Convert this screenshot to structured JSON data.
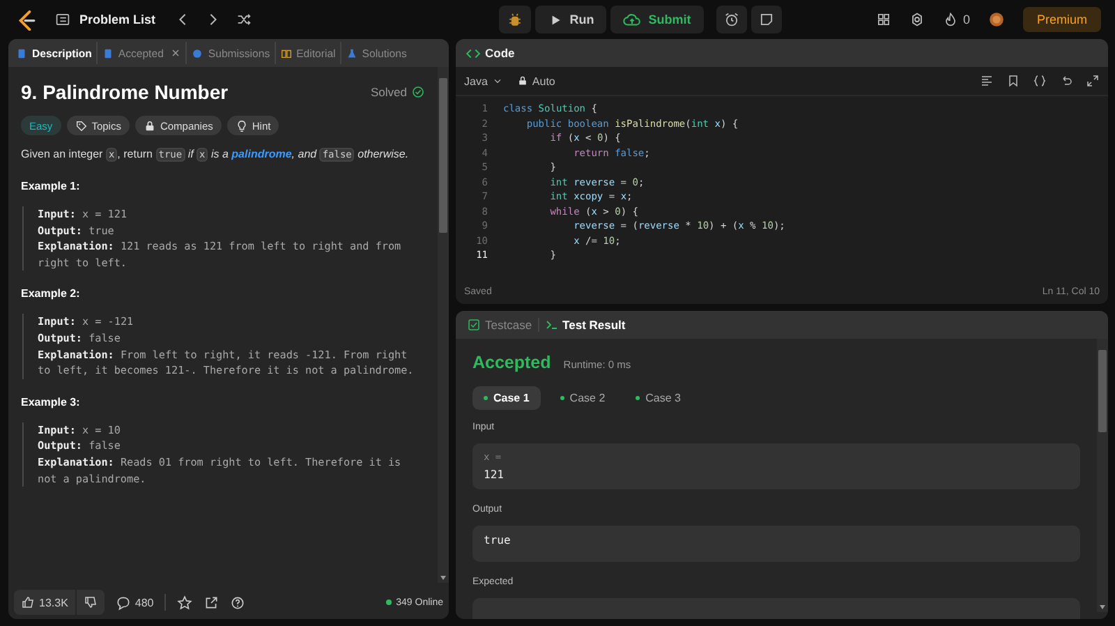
{
  "topbar": {
    "title": "Problem List",
    "run": "Run",
    "submit": "Submit",
    "streak": "0",
    "premium": "Premium"
  },
  "description": {
    "tabs": [
      {
        "label": "Description",
        "selected": true,
        "closable": false
      },
      {
        "label": "Accepted",
        "selected": false,
        "closable": true
      },
      {
        "label": "Submissions",
        "selected": false,
        "closable": false
      },
      {
        "label": "Editorial",
        "selected": false,
        "closable": false
      },
      {
        "label": "Solutions",
        "selected": false,
        "closable": false
      }
    ],
    "title": "9. Palindrome Number",
    "status": "Solved",
    "tags": [
      {
        "label": "Easy",
        "kind": "difficulty"
      },
      {
        "label": "Topics",
        "kind": "topics"
      },
      {
        "label": "Companies",
        "kind": "companies"
      },
      {
        "label": "Hint",
        "kind": "hint"
      }
    ],
    "statement": [
      {
        "text": "Given an integer ",
        "kind": "plain"
      },
      {
        "text": "x",
        "kind": "code"
      },
      {
        "text": ", return ",
        "kind": "plain"
      },
      {
        "text": "true",
        "kind": "code"
      },
      {
        "text": " if ",
        "kind": "italic"
      },
      {
        "text": "x",
        "kind": "code"
      },
      {
        "text": " is a ",
        "kind": "italic"
      },
      {
        "text": "palindrome",
        "kind": "link"
      },
      {
        "text": ", and ",
        "kind": "italic"
      },
      {
        "text": "false",
        "kind": "code"
      },
      {
        "text": " otherwise.",
        "kind": "italic"
      }
    ],
    "examples": [
      {
        "heading": "Example 1:",
        "lines": [
          {
            "label": "Input:",
            "value": "x = 121"
          },
          {
            "label": "Output:",
            "value": "true"
          },
          {
            "label": "Explanation:",
            "value": "121 reads as 121 from left to right and from right to left."
          }
        ]
      },
      {
        "heading": "Example 2:",
        "lines": [
          {
            "label": "Input:",
            "value": "x = -121"
          },
          {
            "label": "Output:",
            "value": "false"
          },
          {
            "label": "Explanation:",
            "value": "From left to right, it reads -121. From right to left, it becomes 121-. Therefore it is not a palindrome."
          }
        ]
      },
      {
        "heading": "Example 3:",
        "lines": [
          {
            "label": "Input:",
            "value": "x = 10"
          },
          {
            "label": "Output:",
            "value": "false"
          },
          {
            "label": "Explanation:",
            "value": "Reads 01 from right to left. Therefore it is not a palindrome."
          }
        ]
      }
    ],
    "likes": "13.3K",
    "comments": "480",
    "online": "349 Online"
  },
  "code": {
    "title": "Code",
    "language": "Java",
    "mode": "Auto",
    "saved": "Saved",
    "cursor": "Ln 11, Col 10",
    "lines": [
      {
        "number": "1",
        "current": false,
        "tokens": [
          {
            "text": "class ",
            "kind": "kw"
          },
          {
            "text": "Solution",
            "kind": "type"
          },
          {
            "text": " {",
            "kind": "p"
          }
        ]
      },
      {
        "number": "2",
        "current": false,
        "tokens": [
          {
            "text": "    public ",
            "kind": "kw"
          },
          {
            "text": "boolean ",
            "kind": "kw"
          },
          {
            "text": "isPalindrome",
            "kind": "fn"
          },
          {
            "text": "(",
            "kind": "p"
          },
          {
            "text": "int ",
            "kind": "type"
          },
          {
            "text": "x",
            "kind": "var"
          },
          {
            "text": ") {",
            "kind": "p"
          }
        ]
      },
      {
        "number": "3",
        "current": false,
        "tokens": [
          {
            "text": "        if",
            "kind": "ctrl"
          },
          {
            "text": " (",
            "kind": "p"
          },
          {
            "text": "x",
            "kind": "var"
          },
          {
            "text": " < ",
            "kind": "p"
          },
          {
            "text": "0",
            "kind": "num"
          },
          {
            "text": ") {",
            "kind": "p"
          }
        ]
      },
      {
        "number": "4",
        "current": false,
        "tokens": [
          {
            "text": "            return ",
            "kind": "ctrl"
          },
          {
            "text": "false",
            "kind": "kw"
          },
          {
            "text": ";",
            "kind": "p"
          }
        ]
      },
      {
        "number": "5",
        "current": false,
        "tokens": [
          {
            "text": "        }",
            "kind": "p"
          }
        ]
      },
      {
        "number": "6",
        "current": false,
        "tokens": [
          {
            "text": "        int ",
            "kind": "type"
          },
          {
            "text": "reverse",
            "kind": "var"
          },
          {
            "text": " = ",
            "kind": "p"
          },
          {
            "text": "0",
            "kind": "num"
          },
          {
            "text": ";",
            "kind": "p"
          }
        ]
      },
      {
        "number": "7",
        "current": false,
        "tokens": [
          {
            "text": "        int ",
            "kind": "type"
          },
          {
            "text": "xcopy",
            "kind": "var"
          },
          {
            "text": " = ",
            "kind": "p"
          },
          {
            "text": "x",
            "kind": "var"
          },
          {
            "text": ";",
            "kind": "p"
          }
        ]
      },
      {
        "number": "8",
        "current": false,
        "tokens": [
          {
            "text": "        while",
            "kind": "ctrl"
          },
          {
            "text": " (",
            "kind": "p"
          },
          {
            "text": "x",
            "kind": "var"
          },
          {
            "text": " > ",
            "kind": "p"
          },
          {
            "text": "0",
            "kind": "num"
          },
          {
            "text": ") {",
            "kind": "p"
          }
        ]
      },
      {
        "number": "9",
        "current": false,
        "tokens": [
          {
            "text": "            reverse",
            "kind": "var"
          },
          {
            "text": " = (",
            "kind": "p"
          },
          {
            "text": "reverse",
            "kind": "var"
          },
          {
            "text": " * ",
            "kind": "p"
          },
          {
            "text": "10",
            "kind": "num"
          },
          {
            "text": ") + (",
            "kind": "p"
          },
          {
            "text": "x",
            "kind": "var"
          },
          {
            "text": " % ",
            "kind": "p"
          },
          {
            "text": "10",
            "kind": "num"
          },
          {
            "text": ");",
            "kind": "p"
          }
        ]
      },
      {
        "number": "10",
        "current": false,
        "tokens": [
          {
            "text": "            x",
            "kind": "var"
          },
          {
            "text": " /= ",
            "kind": "p"
          },
          {
            "text": "10",
            "kind": "num"
          },
          {
            "text": ";",
            "kind": "p"
          }
        ]
      },
      {
        "number": "11",
        "current": true,
        "tokens": [
          {
            "text": "        }",
            "kind": "p"
          }
        ]
      }
    ]
  },
  "result": {
    "tabs": [
      {
        "label": "Testcase",
        "selected": false
      },
      {
        "label": "Test Result",
        "selected": true
      }
    ],
    "verdict": "Accepted",
    "runtime": "Runtime: 0 ms",
    "cases": [
      {
        "label": "Case 1",
        "selected": true
      },
      {
        "label": "Case 2",
        "selected": false
      },
      {
        "label": "Case 3",
        "selected": false
      }
    ],
    "sections": [
      {
        "label": "Input",
        "variable": "x =",
        "value": "121"
      },
      {
        "label": "Output",
        "value": "true"
      },
      {
        "label": "Expected"
      }
    ]
  }
}
